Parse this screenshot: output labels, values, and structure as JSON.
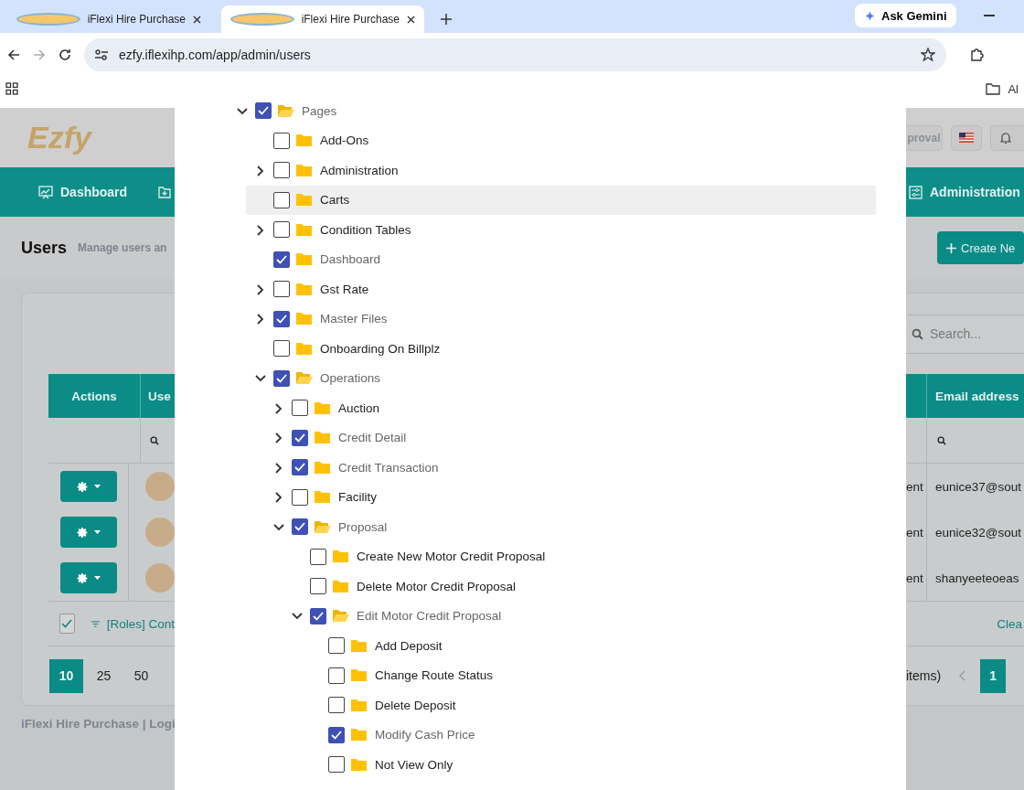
{
  "browser": {
    "tabs": [
      {
        "title": "iFlexi Hire Purchase",
        "selected": false
      },
      {
        "title": "iFlexi Hire Purchase",
        "selected": true
      }
    ],
    "gemini_button": "Ask Gemini",
    "url": "ezfy.iflexihp.com/app/admin/users",
    "bookmark_folder": "Al"
  },
  "app": {
    "logo": "Ezfy",
    "approval_button": "proval",
    "nav_left": "Dashboard",
    "nav_right": "Administration",
    "page_title": "Users",
    "page_subtitle": "Manage users an",
    "create_button": "Create Ne",
    "search": {
      "placeholder": "Search..."
    },
    "table": {
      "columns": [
        "Actions",
        "Use",
        "Email address"
      ],
      "rows": [
        {
          "column_3": "ent",
          "email": "eunice37@sout"
        },
        {
          "column_3": "ent",
          "email": "eunice32@sout"
        },
        {
          "column_3": "ent",
          "email": "shanyeeteoeas"
        }
      ],
      "footer": {
        "select_all": true,
        "filter": "[Roles] Cont",
        "clear": "Clea"
      }
    },
    "pagination": {
      "page_sizes": [
        {
          "label": "10",
          "selected": true
        },
        {
          "label": "25",
          "selected": false
        },
        {
          "label": "50",
          "selected": false
        }
      ],
      "info": "items)",
      "pages": [
        {
          "label": "1",
          "selected": true
        }
      ]
    },
    "footer_text": "iFlexi Hire Purchase | Logi"
  },
  "tree": [
    {
      "label": "Pages",
      "kind": "branch",
      "checked": true,
      "expanded": true,
      "children": [
        {
          "label": "Add-Ons",
          "kind": "leaf",
          "checked": false
        },
        {
          "label": "Administration",
          "kind": "branch",
          "checked": false,
          "expanded": false
        },
        {
          "label": "Carts",
          "kind": "leaf",
          "checked": false,
          "hovered": true
        },
        {
          "label": "Condition Tables",
          "kind": "branch",
          "checked": false,
          "expanded": false
        },
        {
          "label": "Dashboard",
          "kind": "leaf",
          "checked": true
        },
        {
          "label": "Gst Rate",
          "kind": "branch",
          "checked": false,
          "expanded": false
        },
        {
          "label": "Master Files",
          "kind": "branch",
          "checked": true,
          "expanded": false
        },
        {
          "label": "Onboarding On Billplz",
          "kind": "leaf",
          "checked": false
        },
        {
          "label": "Operations",
          "kind": "branch",
          "checked": true,
          "expanded": true,
          "children": [
            {
              "label": "Auction",
              "kind": "branch",
              "checked": false,
              "expanded": false
            },
            {
              "label": "Credit Detail",
              "kind": "branch",
              "checked": true,
              "expanded": false
            },
            {
              "label": "Credit Transaction",
              "kind": "branch",
              "checked": true,
              "expanded": false
            },
            {
              "label": "Facility",
              "kind": "branch",
              "checked": false,
              "expanded": false
            },
            {
              "label": "Proposal",
              "kind": "branch",
              "checked": true,
              "expanded": true,
              "children": [
                {
                  "label": "Create New Motor Credit Proposal",
                  "kind": "leaf",
                  "checked": false
                },
                {
                  "label": "Delete Motor Credit Proposal",
                  "kind": "leaf",
                  "checked": false
                },
                {
                  "label": "Edit Motor Credit Proposal",
                  "kind": "branch",
                  "checked": true,
                  "expanded": true,
                  "children": [
                    {
                      "label": "Add Deposit",
                      "checked": false
                    },
                    {
                      "label": "Change Route Status",
                      "checked": false
                    },
                    {
                      "label": "Delete Deposit",
                      "checked": false
                    },
                    {
                      "label": "Modify Cash Price",
                      "checked": true
                    },
                    {
                      "label": "Not View Only",
                      "checked": false
                    }
                  ]
                }
              ]
            }
          ]
        }
      ]
    }
  ]
}
